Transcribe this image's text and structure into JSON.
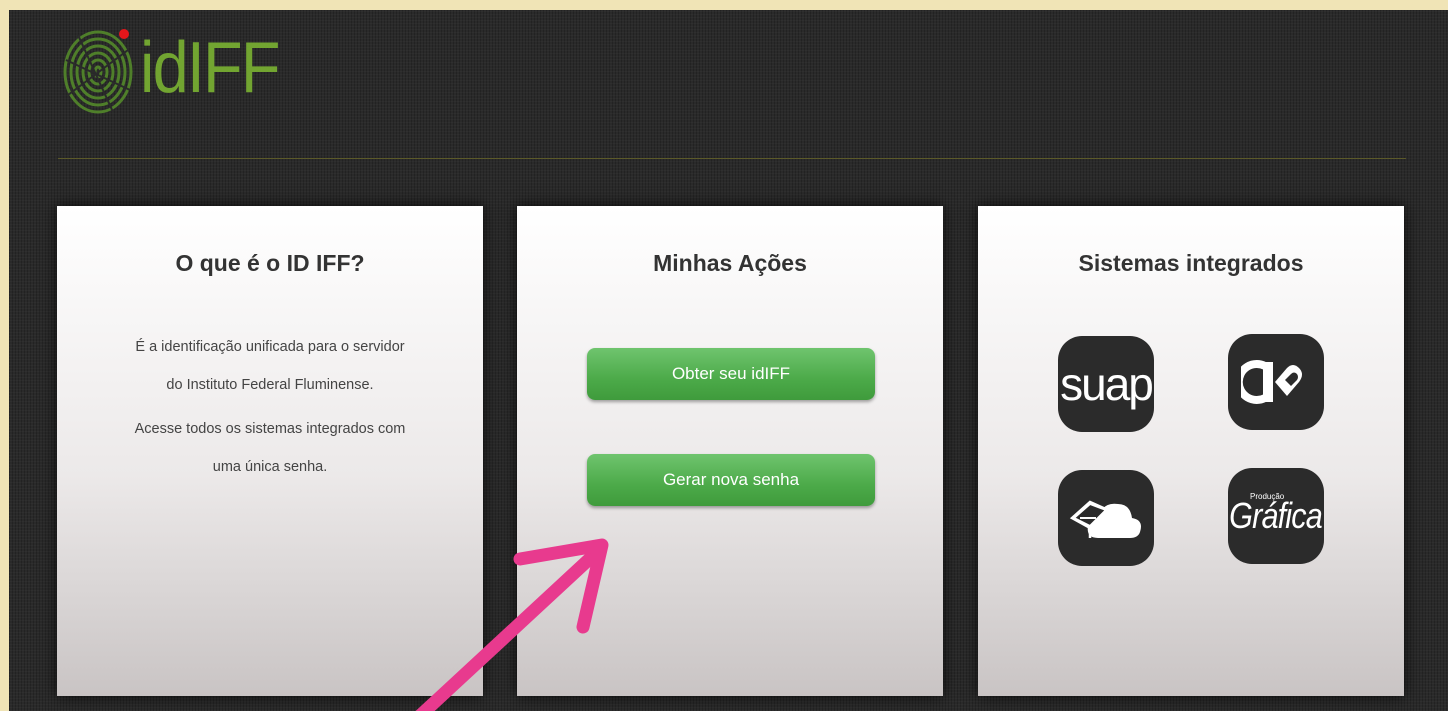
{
  "header": {
    "logo_text": "idIFF",
    "logo_icon": "fingerprint-icon"
  },
  "cards": {
    "about": {
      "title": "O que é o ID IFF?",
      "line1": "É a identificação unificada para o servidor",
      "line2": "do Instituto Federal Fluminense.",
      "line3": "Acesse todos os sistemas integrados com",
      "line4": "uma única senha."
    },
    "actions": {
      "title": "Minhas Ações",
      "obtain_button": "Obter seu idIFF",
      "reset_button": "Gerar nova senha"
    },
    "systems": {
      "title": "Sistemas integrados",
      "items": [
        {
          "name": "suap",
          "label": "suap",
          "icon": "suap-icon"
        },
        {
          "name": "mug",
          "label": "",
          "icon": "mug-heart-icon"
        },
        {
          "name": "cloud",
          "label": "",
          "icon": "box-cloud-icon"
        },
        {
          "name": "grafica",
          "label": "Gráfica",
          "sublabel": "Produção",
          "icon": "grafica-icon"
        }
      ]
    }
  },
  "colors": {
    "accent_green": "#72a531",
    "button_green": "#4caa49",
    "arrow_pink": "#e83a8e",
    "background_dark": "#2a2a2a"
  }
}
